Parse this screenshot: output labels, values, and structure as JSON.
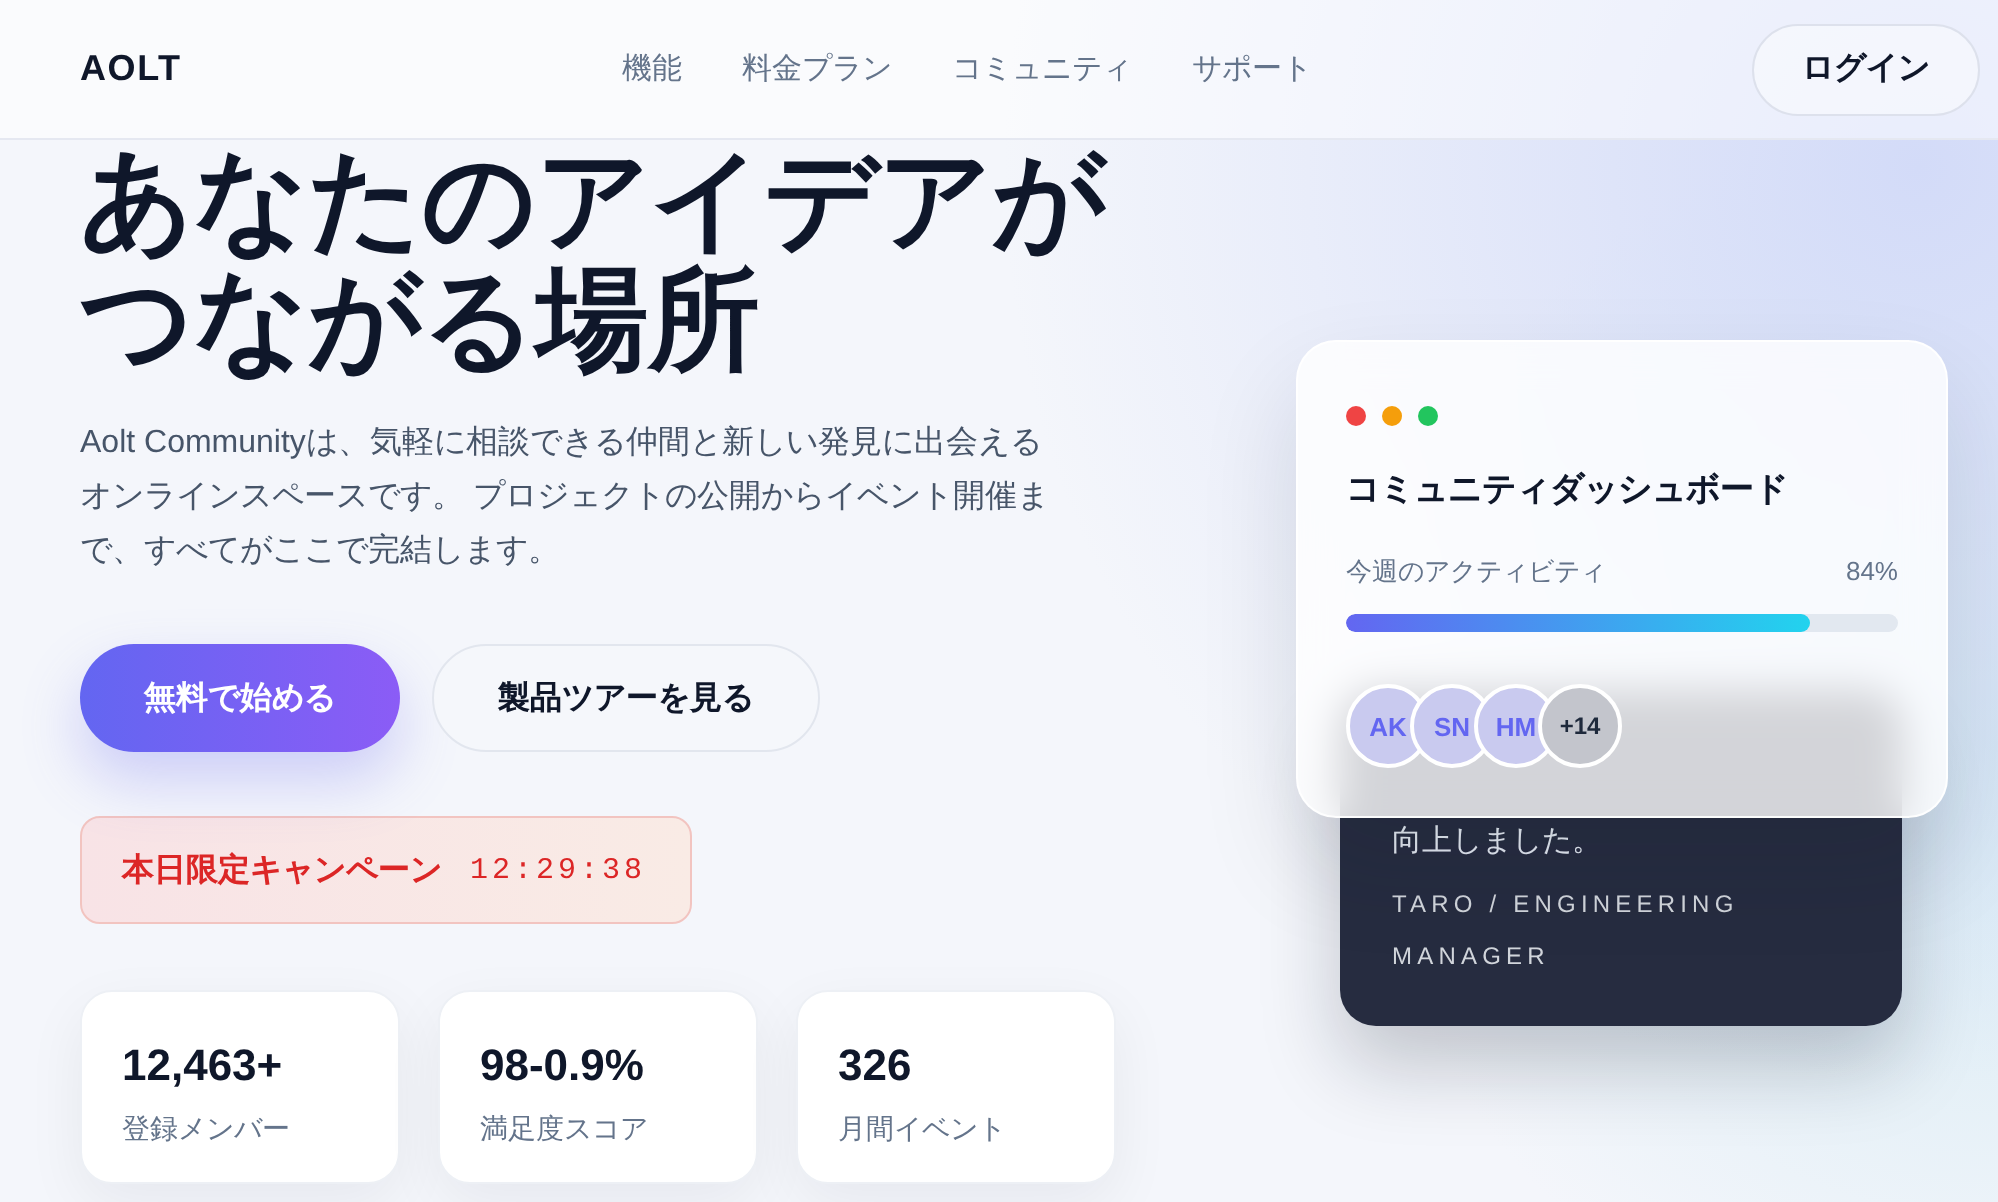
{
  "header": {
    "logo": "AOLT",
    "nav": [
      {
        "label": "機能"
      },
      {
        "label": "料金プラン"
      },
      {
        "label": "コミュニティ"
      },
      {
        "label": "サポート"
      }
    ],
    "login_button": "ログイン"
  },
  "hero": {
    "title": "あなたのアイデアがつながる場所",
    "description": "Aolt Communityは、気軽に相談できる仲間と新しい発見に出会えるオンラインスペースです。 プロジェクトの公開からイベント開催まで、すべてがここで完結します。",
    "buttons": [
      {
        "label": "無料で始める",
        "kind": "primary"
      },
      {
        "label": "製品ツアーを見る",
        "kind": "secondary"
      }
    ],
    "campaign": {
      "label": "本日限定キャンペーン",
      "timer": "12:29:38"
    },
    "stats": [
      {
        "value": "12,463+",
        "label": "登録メンバー"
      },
      {
        "value": "98-0.9%",
        "label": "満足度スコア"
      },
      {
        "value": "326",
        "label": "月間イベント"
      }
    ]
  },
  "dashboard": {
    "window_dots": [
      {
        "color": "#ef4444"
      },
      {
        "color": "#f59e0b"
      },
      {
        "color": "#22c55e"
      }
    ],
    "title": "コミュニティダッシュボード",
    "activity": {
      "label": "今週のアクティビティ",
      "reading": "84%",
      "level": 0.84
    },
    "avatars": [
      {
        "initials": "AK",
        "kind": "member"
      },
      {
        "initials": "SN",
        "kind": "member"
      },
      {
        "initials": "HM",
        "kind": "member"
      },
      {
        "initials": "+14",
        "kind": "more"
      }
    ]
  },
  "testimonial": {
    "quote": "向上しました。",
    "author": "TARO / ENGINEERING MANAGER"
  }
}
